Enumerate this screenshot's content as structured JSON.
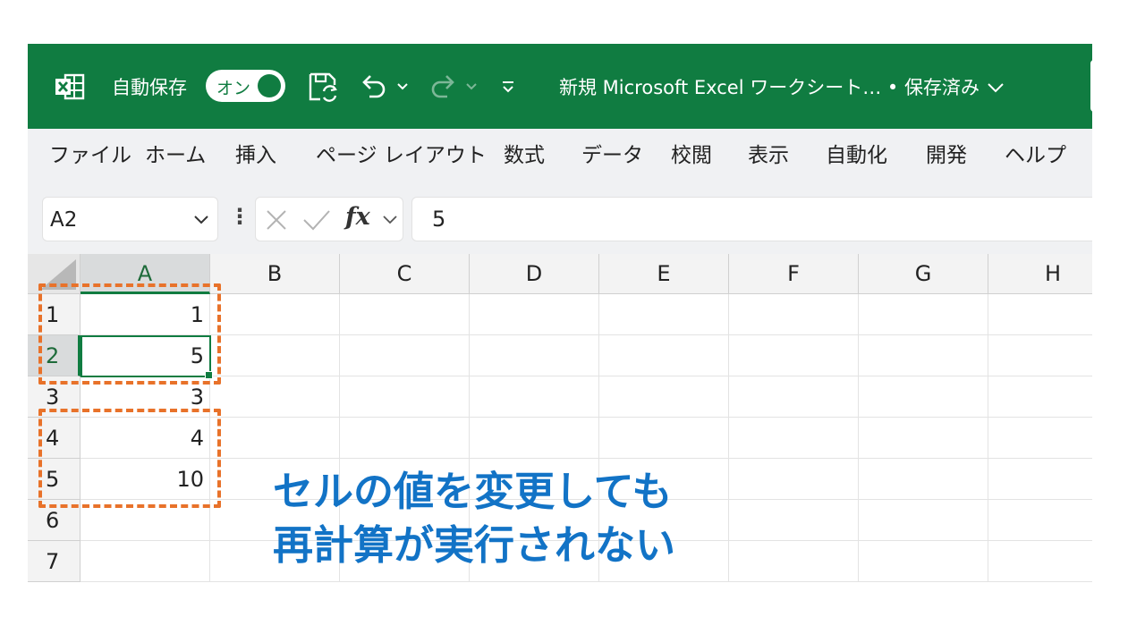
{
  "title_bar": {
    "autosave_label": "自動保存",
    "autosave_toggle": "オン",
    "document_title": "新規 Microsoft Excel ワークシート… • 保存済み",
    "colors": {
      "excel_green": "#107c41"
    }
  },
  "ribbon": {
    "tabs": [
      "ファイル",
      "ホーム",
      "挿入",
      "ページ レイアウト",
      "数式",
      "データ",
      "校閲",
      "表示",
      "自動化",
      "開発",
      "ヘルプ"
    ]
  },
  "formula_bar": {
    "name_box": "A2",
    "fx_label": "fx",
    "formula_value": "5"
  },
  "grid": {
    "columns": [
      "A",
      "B",
      "C",
      "D",
      "E",
      "F",
      "G",
      "H"
    ],
    "rows": [
      "1",
      "2",
      "3",
      "4",
      "5",
      "6",
      "7"
    ],
    "column_a_values": [
      "1",
      "5",
      "3",
      "4",
      "10",
      "",
      ""
    ],
    "selected_cell": "A2"
  },
  "annotation": {
    "line1": "セルの値を変更しても",
    "line2": "再計算が実行されない",
    "color": "#1273c6",
    "highlight_color": "#e8722a"
  }
}
